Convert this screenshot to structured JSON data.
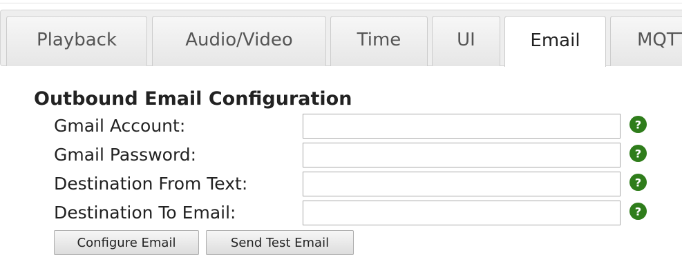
{
  "tabs": [
    {
      "label": "Playback",
      "active": false
    },
    {
      "label": "Audio/Video",
      "active": false
    },
    {
      "label": "Time",
      "active": false
    },
    {
      "label": "UI",
      "active": false
    },
    {
      "label": "Email",
      "active": true
    },
    {
      "label": "MQTT",
      "active": false
    }
  ],
  "section": {
    "title": "Outbound Email Configuration"
  },
  "fields": [
    {
      "label": "Gmail Account:",
      "value": "",
      "help_icon": "question-circle-icon"
    },
    {
      "label": "Gmail Password:",
      "value": "",
      "help_icon": "question-circle-icon"
    },
    {
      "label": "Destination From Text:",
      "value": "",
      "help_icon": "question-circle-icon"
    },
    {
      "label": "Destination To Email:",
      "value": "",
      "help_icon": "question-circle-icon"
    }
  ],
  "buttons": {
    "configure_label": "Configure Email",
    "send_test_label": "Send Test Email"
  },
  "colors": {
    "help_icon": "#2f7d1b",
    "tab_bar": "#eeeeee"
  }
}
